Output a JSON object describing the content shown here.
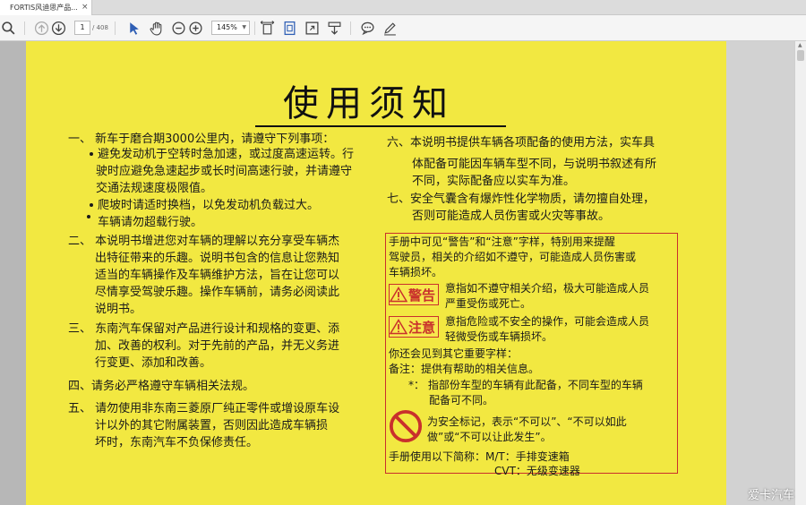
{
  "tab": {
    "title": "FORTIS风迪思产品...",
    "close": "×"
  },
  "toolbar": {
    "page_current": "1",
    "page_total": "/ 408",
    "zoom": "145%"
  },
  "document": {
    "title": "使用须知",
    "left_lines": [
      "一、  新车于磨合期3000公里内，请遵守下列事项：",
      "避免发动机于空转时急加速，或过度高速运转。行",
      "驶时应避免急速起步或长时间高速行驶，并请遵守",
      "交通法规速度极限值。",
      "爬坡时请适时换档，以免发动机负载过大。",
      "车辆请勿超载行驶。",
      "二、  本说明书增进您对车辆的理解以充分享受车辆杰",
      "出特征带来的乐趣。说明书包含的信息让您熟知",
      "适当的车辆操作及车辆维护方法，旨在让您可以",
      "尽情享受驾驶乐趣。操作车辆前，请务必阅读此",
      "说明书。",
      "三、  东南汽车保留对产品进行设计和规格的变更、添",
      "加、改善的权利。对于先前的产品，并无义务进",
      "行变更、添加和改善。",
      "四、请务必严格遵守车辆相关法规。",
      "五、  请勿使用非东南三菱原厂纯正零件或增设原车设",
      "计以外的其它附属装置，否则因此造成车辆损",
      "坏时，东南汽车不负保修责任。"
    ],
    "right_lines": [
      "六、本说明书提供车辆各项配备的使用方法，实车具",
      "体配备可能因车辆车型不同，与说明书叙述有所",
      "不同，实际配备应以实车为准。",
      "七、安全气囊含有爆炸性化学物质，请勿擅自处理，",
      "否则可能造成人员伤害或火灾等事故。"
    ],
    "notice_lines": [
      "手册中可见“警告”和“注意”字样，特别用来提醒",
      "驾驶员，相关的介绍如不遵守，可能造成人员伤害或",
      "车辆损坏。",
      "意指如不遵守相关介绍，极大可能造成人员",
      "严重受伤或死亡。",
      "意指危险或不安全的操作，可能会造成人员",
      "轻微受伤或车辆损坏。",
      "你还会见到其它重要字样：",
      "备注：提供有帮助的相关信息。",
      "*：  指部份车型的车辆有此配备，不同车型的车辆",
      "配备可不同。",
      "为安全标记，表示“不可以”、“不可以如此",
      "做”或“不可以让此发生”。",
      "手册使用以下简称：M/T：手排变速箱",
      "CVT：无级变速器"
    ],
    "badges": {
      "warning": "警告",
      "caution": "注意"
    }
  },
  "watermark": "爱卡汽车",
  "colors": {
    "page": "#f2e841",
    "accent_red": "#c9302c",
    "viewer_bg": "#ababab"
  }
}
